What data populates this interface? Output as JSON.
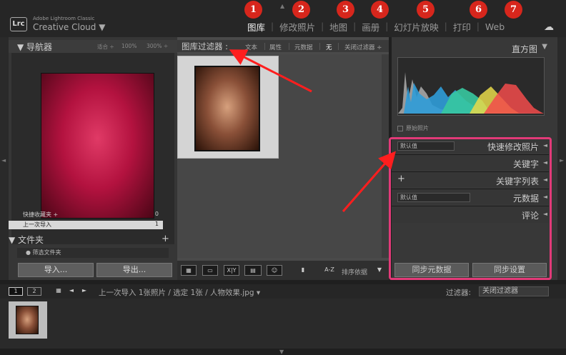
{
  "app": {
    "brand_small": "Adobe Lightroom Classic",
    "brand_name": "Creative Cloud",
    "brand_caret": "▼",
    "logo": "Lrc"
  },
  "modules": [
    {
      "label": "图库",
      "badge": "1",
      "active": true
    },
    {
      "label": "修改照片",
      "badge": "2"
    },
    {
      "label": "地图",
      "badge": "3"
    },
    {
      "label": "画册",
      "badge": "4"
    },
    {
      "label": "幻灯片放映",
      "badge": "5"
    },
    {
      "label": "打印",
      "badge": "6"
    },
    {
      "label": "Web",
      "badge": "7"
    }
  ],
  "navigator": {
    "title": "导航器",
    "zoom_fit": "适合 ÷",
    "zoom_100": "100%",
    "zoom_300": "300% ÷"
  },
  "catalog": {
    "favorites": "快捷收藏夹 +",
    "favorites_count": "0",
    "recent": "上一次导入",
    "recent_count": "1"
  },
  "folders": {
    "title": "文件夹",
    "plus": "+",
    "filter": "筛选文件夹"
  },
  "left_buttons": {
    "import": "导入...",
    "export": "导出..."
  },
  "filter_bar": {
    "title": "图库过滤器 :",
    "items": [
      "文本",
      "属性",
      "元数据",
      "无",
      "关闭过滤器 ÷"
    ]
  },
  "toolbar": {
    "sort_label": "排序依据",
    "sort_icon": "A-Z",
    "menu_icon": "▼"
  },
  "histogram": {
    "title": "直方图",
    "arrow": "▼",
    "original_photo": "原始照片"
  },
  "right_sections": [
    {
      "select": "默认值",
      "title": "快速修改照片",
      "arrow": "◄"
    },
    {
      "title": "关键字",
      "arrow": "◄"
    },
    {
      "plus": "+",
      "title": "关键字列表",
      "arrow": "◄"
    },
    {
      "select": "默认值",
      "title": "元数据",
      "arrow": "◄"
    },
    {
      "title": "评论",
      "arrow": "◄"
    }
  ],
  "right_buttons": {
    "sync_metadata": "同步元数据",
    "sync_settings": "同步设置"
  },
  "filmstrip": {
    "screen1": "1",
    "screen2": "2",
    "path": "上一次导入  1张照片 / 选定 1张 / 人物效果.jpg ▾",
    "filter_label": "过滤器:",
    "filter_value": "关闭过滤器"
  },
  "colors": {
    "badge": "#d7261c",
    "highlight": "#e23a78",
    "arrow": "#ff1e1e"
  }
}
